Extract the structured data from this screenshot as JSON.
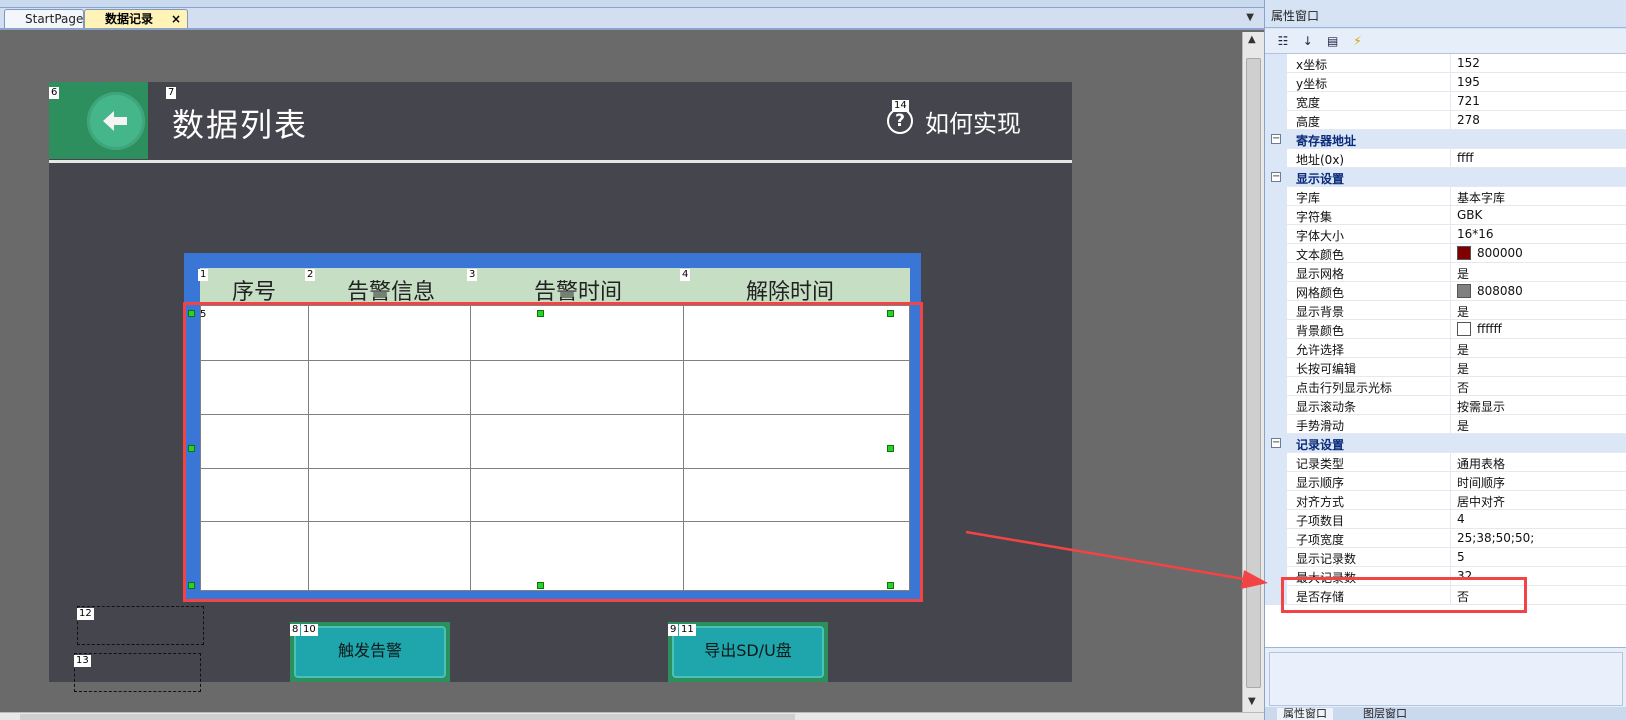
{
  "tabs": [
    {
      "label": "StartPage"
    },
    {
      "label": "数据记录",
      "close": "×"
    }
  ],
  "screen": {
    "title": "数据列表",
    "help_label": "如何实现",
    "ids": {
      "back_block": "6",
      "title": "7",
      "help": "14",
      "h1": "1",
      "h2": "2",
      "h3": "3",
      "h4": "4",
      "table": "5",
      "box1": "12",
      "box2": "13",
      "btn1_a": "8",
      "btn1_b": "10",
      "btn2_a": "9",
      "btn2_b": "11"
    },
    "table": {
      "headers": [
        "序号",
        "告警信息",
        "告警时间",
        "解除时间"
      ],
      "rows": 5
    },
    "buttons": {
      "trigger_alarm": "触发告警",
      "export": "导出SD/U盘"
    }
  },
  "panel": {
    "title": "属性窗口",
    "properties": [
      {
        "type": "prop",
        "name": "x坐标",
        "value": "152"
      },
      {
        "type": "prop",
        "name": "y坐标",
        "value": "195"
      },
      {
        "type": "prop",
        "name": "宽度",
        "value": "721"
      },
      {
        "type": "prop",
        "name": "高度",
        "value": "278"
      },
      {
        "type": "cat",
        "name": "寄存器地址"
      },
      {
        "type": "prop",
        "name": "地址(0x)",
        "value": "ffff"
      },
      {
        "type": "cat",
        "name": "显示设置"
      },
      {
        "type": "prop",
        "name": "字库",
        "value": "基本字库"
      },
      {
        "type": "prop",
        "name": "字符集",
        "value": "GBK"
      },
      {
        "type": "prop",
        "name": "字体大小",
        "value": "16*16"
      },
      {
        "type": "prop",
        "name": "文本颜色",
        "value": "800000",
        "color": "#800000"
      },
      {
        "type": "prop",
        "name": "显示网格",
        "value": "是"
      },
      {
        "type": "prop",
        "name": "网格颜色",
        "value": "808080",
        "color": "#808080"
      },
      {
        "type": "prop",
        "name": "显示背景",
        "value": "是"
      },
      {
        "type": "prop",
        "name": "背景颜色",
        "value": "ffffff",
        "color": "#ffffff"
      },
      {
        "type": "prop",
        "name": "允许选择",
        "value": "是"
      },
      {
        "type": "prop",
        "name": "长按可编辑",
        "value": "是"
      },
      {
        "type": "prop",
        "name": "点击行列显示光标",
        "value": "否"
      },
      {
        "type": "prop",
        "name": "显示滚动条",
        "value": "按需显示"
      },
      {
        "type": "prop",
        "name": "手势滑动",
        "value": "是"
      },
      {
        "type": "cat",
        "name": "记录设置"
      },
      {
        "type": "prop",
        "name": "记录类型",
        "value": "通用表格"
      },
      {
        "type": "prop",
        "name": "显示顺序",
        "value": "时间顺序"
      },
      {
        "type": "prop",
        "name": "对齐方式",
        "value": "居中对齐"
      },
      {
        "type": "prop",
        "name": "子项数目",
        "value": "4"
      },
      {
        "type": "prop",
        "name": "子项宽度",
        "value": "25;38;50;50;"
      },
      {
        "type": "prop",
        "name": "显示记录数",
        "value": "5"
      },
      {
        "type": "prop",
        "name": "最大记录数",
        "value": "32"
      },
      {
        "type": "prop",
        "name": "是否存储",
        "value": "否"
      }
    ],
    "bottom_tabs": [
      "属性窗口",
      "图层窗口"
    ]
  },
  "colors": {
    "accent": "#3a76d6",
    "highlight": "#f24444",
    "button_green": "#2e8f5e"
  }
}
